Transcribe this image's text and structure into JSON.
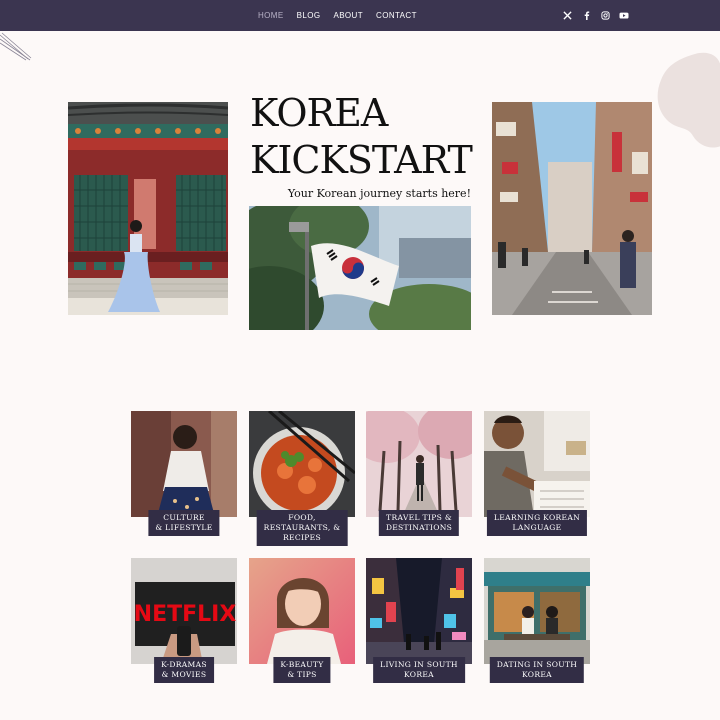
{
  "nav": {
    "items": [
      {
        "label": "HOME",
        "active": true
      },
      {
        "label": "BLOG",
        "active": false
      },
      {
        "label": "ABOUT",
        "active": false
      },
      {
        "label": "CONTACT",
        "active": false
      }
    ],
    "social_icons": [
      "x-icon",
      "facebook-icon",
      "instagram-icon",
      "youtube-icon"
    ]
  },
  "hero": {
    "title_line1": "KOREA",
    "title_line2": "KICKSTART",
    "subtitle": "Your Korean journey starts here!"
  },
  "categories": [
    {
      "line1": "CULTURE",
      "line2": "& LIFESTYLE",
      "line3": ""
    },
    {
      "line1": "FOOD,",
      "line2": "RESTAURANTS, &",
      "line3": "RECIPES"
    },
    {
      "line1": "TRAVEL TIPS &",
      "line2": "DESTINATIONS",
      "line3": ""
    },
    {
      "line1": "LEARNING KOREAN",
      "line2": "LANGUAGE",
      "line3": ""
    },
    {
      "line1": "K-DRAMAS",
      "line2": "& MOVIES",
      "line3": "",
      "image_text": "NETFLIX"
    },
    {
      "line1": "K-BEAUTY",
      "line2": "& TIPS",
      "line3": ""
    },
    {
      "line1": "LIVING IN SOUTH",
      "line2": "KOREA",
      "line3": ""
    },
    {
      "line1": "DATING IN SOUTH",
      "line2": "KOREA",
      "line3": ""
    }
  ],
  "colors": {
    "topbar": "#3b3550",
    "label_bg": "#322d45",
    "page_bg": "#fdf9f8",
    "blob": "#ebe1df"
  }
}
